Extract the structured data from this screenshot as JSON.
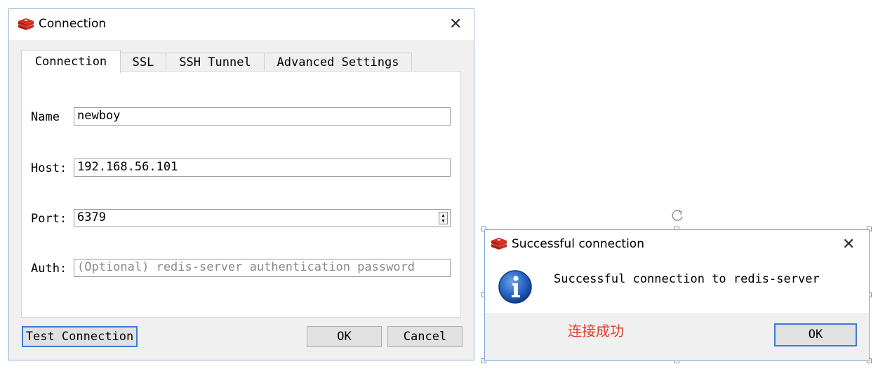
{
  "connection_window": {
    "title": "Connection",
    "close_glyph": "✕",
    "tabs": [
      {
        "label": "Connection",
        "active": true
      },
      {
        "label": "SSL",
        "active": false
      },
      {
        "label": "SSH Tunnel",
        "active": false
      },
      {
        "label": "Advanced Settings",
        "active": false
      }
    ],
    "fields": {
      "name": {
        "label": "Name",
        "value": "newboy"
      },
      "host": {
        "label": "Host:",
        "value": "192.168.56.101"
      },
      "port": {
        "label": "Port:",
        "value": "6379"
      },
      "auth": {
        "label": "Auth:",
        "value": "",
        "placeholder": "(Optional) redis-server authentication password"
      }
    },
    "buttons": {
      "test_connection": "Test Connection",
      "ok": "OK",
      "cancel": "Cancel"
    }
  },
  "success_dialog": {
    "title": "Successful connection",
    "close_glyph": "✕",
    "message": "Successful connection to redis-server",
    "annotation": "连接成功",
    "ok_button": "OK"
  },
  "icons": {
    "app_logo": "redis-logo-icon",
    "info": "info-icon",
    "rotate": "rotate-handle-icon"
  },
  "colors": {
    "window_border": "#9ab6d6",
    "focus_blue": "#3b7bd6",
    "redis_red": "#c6302b",
    "annotation_red": "#e23b2a",
    "info_blue": "#1e5eb8"
  }
}
